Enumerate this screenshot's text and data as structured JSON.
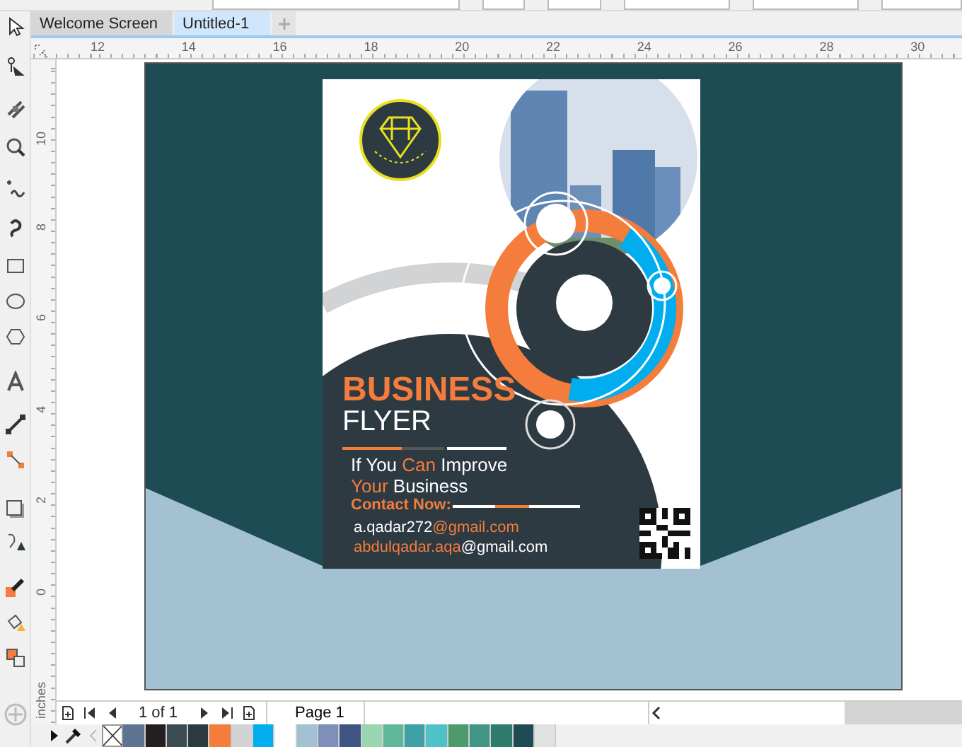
{
  "tabs": [
    {
      "label": "Welcome Screen",
      "selected": false
    },
    {
      "label": "Untitled-1",
      "selected": true
    }
  ],
  "rulers": {
    "horizontal": [
      "12",
      "14",
      "16",
      "18",
      "20",
      "22",
      "24",
      "26",
      "28",
      "30"
    ],
    "vertical": [
      "10",
      "8",
      "6",
      "4",
      "2",
      "0"
    ],
    "units": "inches"
  },
  "flyer": {
    "title": "BUSINESS",
    "subtitle": "FLYER",
    "tagline": [
      [
        {
          "text": "If You ",
          "accent": false
        },
        {
          "text": "Can",
          "accent": true
        },
        {
          "text": " Improve",
          "accent": false
        }
      ],
      [
        {
          "text": "Your",
          "accent": true
        },
        {
          "text": " Business",
          "accent": false
        }
      ]
    ],
    "contact_label": "Contact Now:",
    "emails": [
      [
        {
          "text": "a.qadar272",
          "accent": false
        },
        {
          "text": "@gmail.com",
          "accent": true
        }
      ],
      [
        {
          "text": "abdulqadar.aqa",
          "accent": true
        },
        {
          "text": "@gmail.com",
          "accent": false
        }
      ]
    ]
  },
  "page_navigator": {
    "position": "1 of 1",
    "pages": [
      {
        "label": "Page 1",
        "selected": true
      }
    ]
  },
  "palette": [
    {
      "kind": "none"
    },
    {
      "kind": "color",
      "color": "#5f7392"
    },
    {
      "kind": "color",
      "color": "#231f20"
    },
    {
      "kind": "color",
      "color": "#3d4b55"
    },
    {
      "kind": "color",
      "color": "#2d3a42"
    },
    {
      "kind": "color",
      "color": "#f47c3c"
    },
    {
      "kind": "color",
      "color": "#d1d3d4"
    },
    {
      "kind": "color",
      "color": "#00aeef"
    },
    {
      "kind": "color",
      "color": "#ffffff"
    },
    {
      "kind": "color",
      "color": "#a3c1d3"
    },
    {
      "kind": "color",
      "color": "#7e8fba"
    },
    {
      "kind": "color",
      "color": "#3f5584"
    },
    {
      "kind": "color",
      "color": "#98d5b0"
    },
    {
      "kind": "color",
      "color": "#5fb89a"
    },
    {
      "kind": "color",
      "color": "#3fa0a6"
    },
    {
      "kind": "color",
      "color": "#4fc2c9"
    },
    {
      "kind": "color",
      "color": "#4d9b6d"
    },
    {
      "kind": "color",
      "color": "#419486"
    },
    {
      "kind": "color",
      "color": "#2f7c6e"
    },
    {
      "kind": "color",
      "color": "#1d4c55"
    },
    {
      "kind": "color",
      "color": "#e0e2e2"
    }
  ]
}
